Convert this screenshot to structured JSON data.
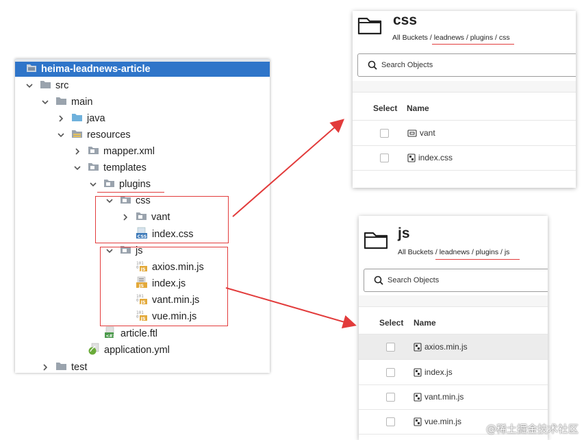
{
  "tree": {
    "project": "heima-leadnews-article",
    "src": "src",
    "main": "main",
    "java": "java",
    "resources": "resources",
    "mapper": "mapper.xml",
    "templates": "templates",
    "plugins": "plugins",
    "css": "css",
    "vant": "vant",
    "index_css": "index.css",
    "js": "js",
    "axios": "axios.min.js",
    "index_js": "index.js",
    "vant_js": "vant.min.js",
    "vue_js": "vue.min.js",
    "article": "article.ftl",
    "application": "application.yml",
    "test": "test"
  },
  "css_panel": {
    "title": "css",
    "breadcrumb": "All Buckets / leadnews / plugins / css",
    "search_placeholder": "Search Objects",
    "col_select": "Select",
    "col_name": "Name",
    "rows": [
      "vant",
      "index.css"
    ]
  },
  "js_panel": {
    "title": "js",
    "breadcrumb": "All Buckets / leadnews / plugins / js",
    "search_placeholder": "Search Objects",
    "col_select": "Select",
    "col_name": "Name",
    "rows": [
      "axios.min.js",
      "index.js",
      "vant.min.js",
      "vue.min.js"
    ]
  },
  "watermark": "@稀土掘金技术社区",
  "colors": {
    "selection": "#2f75c9",
    "annotation_red": "#e23b3b",
    "folder_blue": "#6fb1dc",
    "folder_grey": "#9aa3ad"
  }
}
